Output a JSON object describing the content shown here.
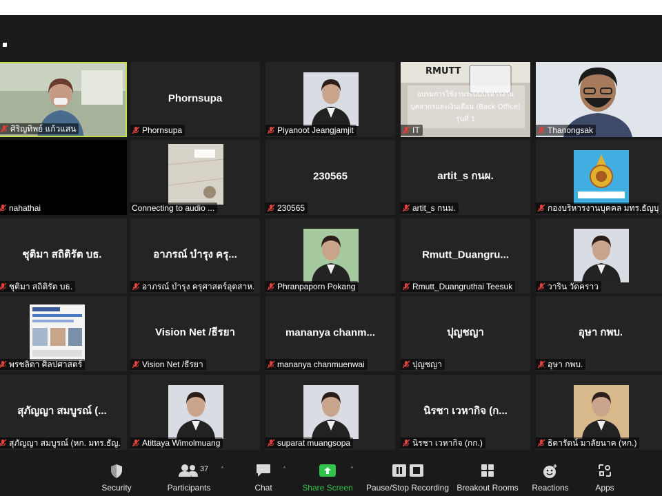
{
  "tiles": [
    {
      "row": 0,
      "col": 0,
      "label": "ศิริญทิพย์ แก้วแสน",
      "type": "video",
      "active": true
    },
    {
      "row": 0,
      "col": 1,
      "label": "Phornsupa",
      "center": "Phornsupa",
      "type": "name"
    },
    {
      "row": 0,
      "col": 2,
      "label": "Piyanoot Jeangjamjit",
      "type": "photo"
    },
    {
      "row": 0,
      "col": 3,
      "label": "IT",
      "type": "slide",
      "slide_logo": "RMUTT",
      "slide_line1": "อบรมการใช้งานระบบบริหารงาน",
      "slide_line2": "บุคลากรและเงินเดือน (Back Office)",
      "slide_line3": "รุ่นที่ 1"
    },
    {
      "row": 0,
      "col": 4,
      "label": "Thanongsak",
      "type": "video2"
    },
    {
      "row": 1,
      "col": 0,
      "label": "nahathai",
      "type": "black"
    },
    {
      "row": 1,
      "col": 1,
      "label": "Connecting to audio ...",
      "type": "ceiling",
      "nomic": true
    },
    {
      "row": 1,
      "col": 2,
      "label": "230565",
      "center": "230565",
      "type": "name"
    },
    {
      "row": 1,
      "col": 3,
      "label": "artit_s กนม.",
      "center": "artit_s กนผ.",
      "type": "name"
    },
    {
      "row": 1,
      "col": 4,
      "label": "กองบริหารงานบุคคล มทร.ธัญบุรี",
      "type": "logo"
    },
    {
      "row": 2,
      "col": 0,
      "label": "ชุติมา  สถิติรัต  บธ.",
      "center": "ชุติมา  สถิติรัต  บธ.",
      "type": "name"
    },
    {
      "row": 2,
      "col": 1,
      "label": "อาภรณ์ บำรุง ครุศาสตร์อุตสาห...",
      "center": "อาภรณ์ บำรุง ครุ...",
      "type": "name"
    },
    {
      "row": 2,
      "col": 2,
      "label": "Phranpaporn Pokang",
      "type": "photo"
    },
    {
      "row": 2,
      "col": 3,
      "label": "Rmutt_Duangruthai Teesuk",
      "center": "Rmutt_Duangru...",
      "type": "name"
    },
    {
      "row": 2,
      "col": 4,
      "label": "วาริน วัดคราว",
      "type": "photo"
    },
    {
      "row": 3,
      "col": 0,
      "label": "พรชลิตา ศิลปศาสตร์",
      "type": "poster"
    },
    {
      "row": 3,
      "col": 1,
      "label": "Vision Net /ธีรยา",
      "center": "Vision Net /ธีรยา",
      "type": "name"
    },
    {
      "row": 3,
      "col": 2,
      "label": "mananya chanmuenwai",
      "center": "mananya  chanm...",
      "type": "name"
    },
    {
      "row": 3,
      "col": 3,
      "label": "ปุญชญา",
      "center": "ปุญชญา",
      "type": "name"
    },
    {
      "row": 3,
      "col": 4,
      "label": "อุษา กพบ.",
      "center": "อุษา กพบ.",
      "type": "name"
    },
    {
      "row": 4,
      "col": 0,
      "label": "สุภัญญา สมบูรณ์ (หก. มทร.ธัญ...",
      "center": "สุภัญญา สมบูรณ์ (...",
      "type": "name"
    },
    {
      "row": 4,
      "col": 1,
      "label": "Atittaya Wimolmuang",
      "type": "photo"
    },
    {
      "row": 4,
      "col": 2,
      "label": "suparat muangsopa",
      "type": "photo"
    },
    {
      "row": 4,
      "col": 3,
      "label": "นิรชา  เวหากิจ (กก.)",
      "center": "นิรชา  เวหากิจ (ก...",
      "type": "name"
    },
    {
      "row": 4,
      "col": 4,
      "label": "ธิดารัตน์ มาลัยนาค (หก.)",
      "type": "photo"
    }
  ],
  "toolbar": {
    "security": "Security",
    "participants": "Participants",
    "participants_count": "37",
    "chat": "Chat",
    "share": "Share Screen",
    "record": "Pause/Stop Recording",
    "breakout": "Breakout Rooms",
    "reactions": "Reactions",
    "apps": "Apps"
  },
  "colors": {
    "active_border": "#c5e04a",
    "share_green": "#31c44a",
    "mute_red": "#e0403a"
  }
}
